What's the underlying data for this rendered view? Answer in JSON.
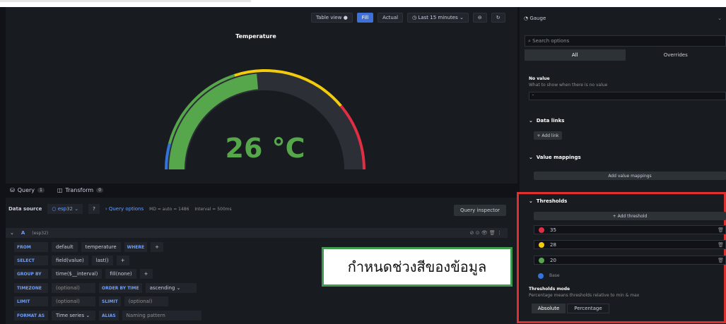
{
  "toolbar": {
    "table_view": "Table view",
    "fill": "Fill",
    "actual": "Actual",
    "time_range": "Last 15 minutes"
  },
  "gauge": {
    "title": "Temperature",
    "value": "26 °C",
    "colors": {
      "green": "#56a64b",
      "yellow": "#f2cc0c",
      "red": "#e02f44",
      "blue": "#3274d9"
    }
  },
  "tabs": {
    "query": "Query",
    "query_count": "1",
    "transform": "Transform",
    "transform_count": "0"
  },
  "datasource": {
    "label": "Data source",
    "name": "esp32",
    "query_options": "Query options",
    "md": "MD = auto = 1486",
    "interval": "Interval = 500ms",
    "inspector": "Query inspector"
  },
  "query": {
    "ref": "A",
    "name": "(esp32)",
    "from": {
      "kw": "FROM",
      "db": "default",
      "measurement": "temperature",
      "where": "WHERE",
      "plus": "+"
    },
    "select": {
      "kw": "SELECT",
      "field": "field(value)",
      "fn": "last()",
      "plus": "+"
    },
    "group": {
      "kw": "GROUP BY",
      "time": "time($__interval)",
      "fill": "fill(none)",
      "plus": "+"
    },
    "timezone": {
      "kw": "TIMEZONE",
      "val": "(optional)",
      "order_kw": "ORDER BY TIME",
      "order": "ascending"
    },
    "limit": {
      "kw": "LIMIT",
      "val": "(optional)",
      "slimit_kw": "SLIMIT",
      "slimit": "(optional)"
    },
    "format": {
      "kw": "FORMAT AS",
      "val": "Time series",
      "alias_kw": "ALIAS",
      "alias": "Naming pattern"
    }
  },
  "annotation": "กำหนดช่วงสีของข้อมูล",
  "side": {
    "viz": "Gauge",
    "search": "Search options",
    "tab_all": "All",
    "tab_overrides": "Overrides",
    "no_value": "No value",
    "no_value_desc": "What to show when there is no value",
    "no_value_input": "-",
    "data_links": "Data links",
    "add_link": "+ Add link",
    "value_mappings": "Value mappings",
    "add_mappings": "Add value mappings",
    "thresholds": "Thresholds",
    "add_threshold": "+ Add threshold",
    "thr": [
      {
        "value": "35",
        "color": "#e02f44"
      },
      {
        "value": "28",
        "color": "#f2cc0c"
      },
      {
        "value": "20",
        "color": "#56a64b"
      },
      {
        "value": "Base",
        "color": "#3274d9"
      }
    ],
    "mode_title": "Thresholds mode",
    "mode_desc": "Percentage means thresholds relative to min & max",
    "absolute": "Absolute",
    "percentage": "Percentage"
  }
}
